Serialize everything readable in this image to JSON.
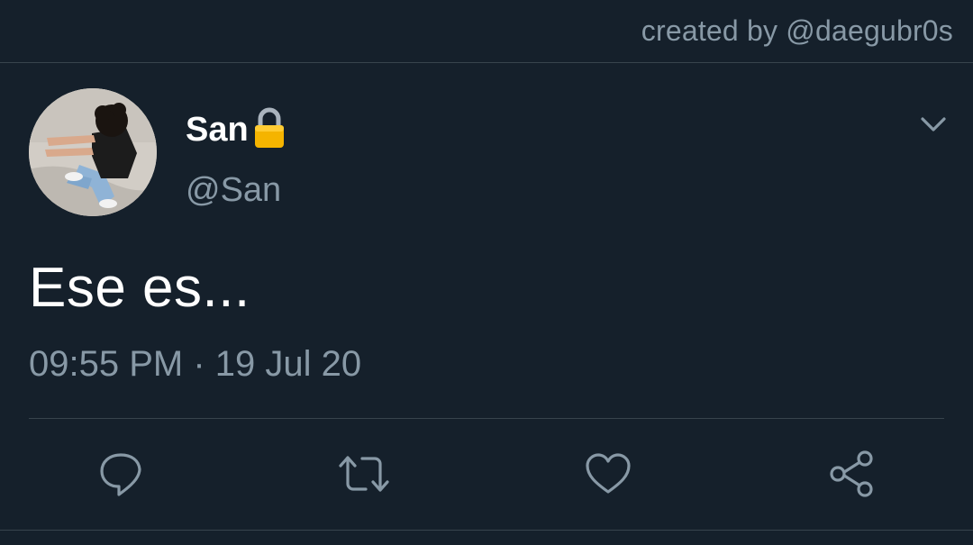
{
  "header": {
    "credit": "created by @daegubr0s"
  },
  "tweet": {
    "display_name": "San",
    "handle": "@San",
    "text": "Ese es...",
    "timestamp": "09:55 PM · 19 Jul 20",
    "protected": true,
    "avatar_icon": "profile-photo"
  },
  "actions": [
    {
      "name": "reply",
      "icon": "speech-bubble-icon"
    },
    {
      "name": "retweet",
      "icon": "retweet-arrows-icon"
    },
    {
      "name": "like",
      "icon": "heart-icon"
    },
    {
      "name": "share",
      "icon": "share-nodes-icon"
    }
  ],
  "colors": {
    "background": "#15202b",
    "divider": "#38444d",
    "secondary_text": "#8899a6",
    "primary_text": "#ffffff",
    "lock": "#f5b400"
  }
}
